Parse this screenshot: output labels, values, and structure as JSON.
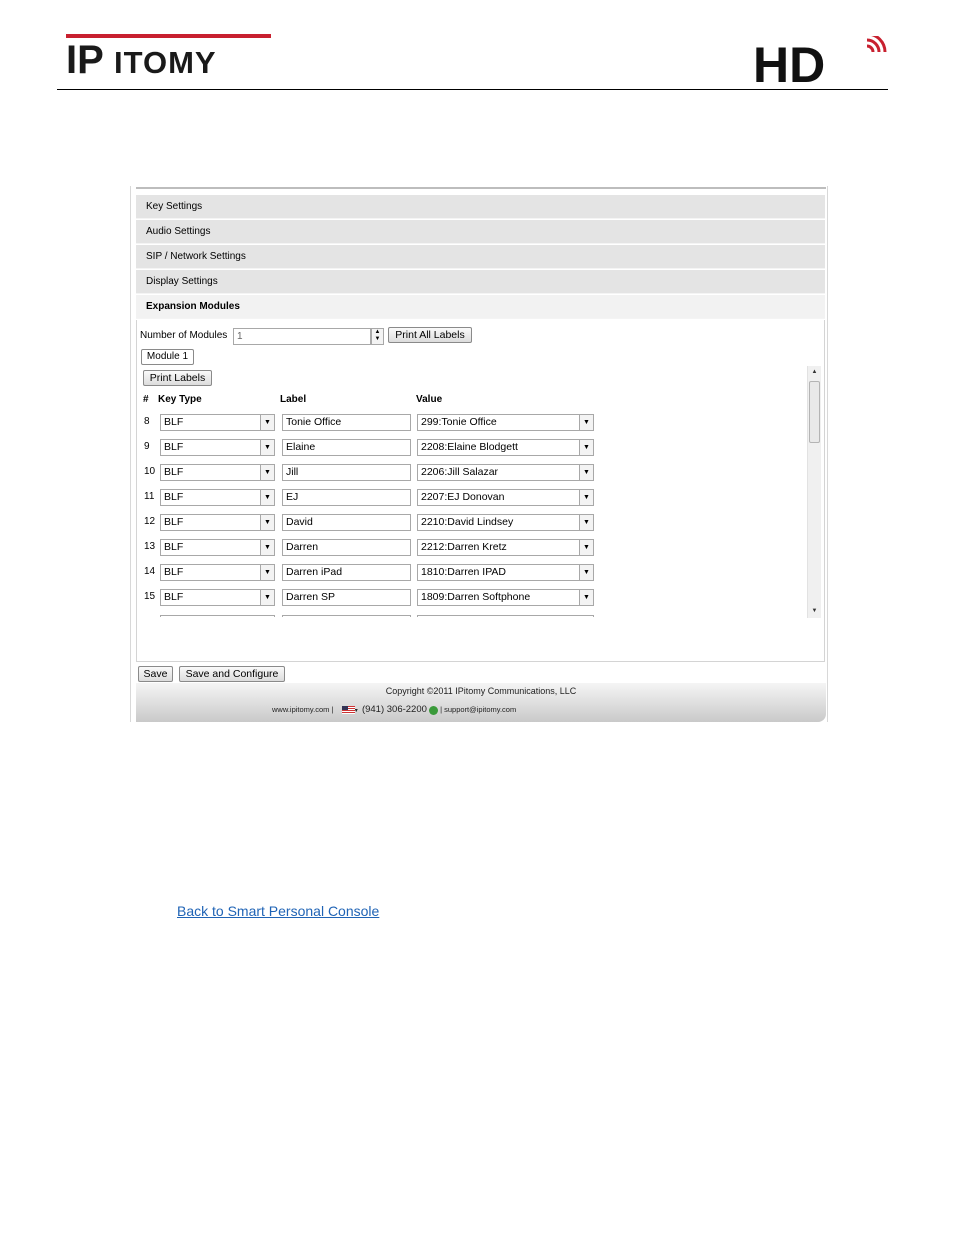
{
  "header": {
    "logo_text": "IPITOMY",
    "hd_logo_text": "HD"
  },
  "accordion": {
    "items": [
      {
        "label": "Key Settings"
      },
      {
        "label": "Audio Settings"
      },
      {
        "label": "SIP / Network Settings"
      },
      {
        "label": "Display Settings"
      },
      {
        "label": "Expansion Modules"
      }
    ],
    "active": "Expansion Modules"
  },
  "expansion": {
    "num_modules_label": "Number of Modules",
    "num_modules_value": "1",
    "print_all_label": "Print All Labels",
    "module_tab": "Module 1",
    "print_labels": "Print Labels",
    "columns": {
      "num": "#",
      "key_type": "Key Type",
      "label": "Label",
      "value": "Value"
    },
    "rows": [
      {
        "num": "8",
        "key_type": "BLF",
        "label": "Tonie Office",
        "value": "299:Tonie Office"
      },
      {
        "num": "9",
        "key_type": "BLF",
        "label": "Elaine",
        "value": "2208:Elaine Blodgett"
      },
      {
        "num": "10",
        "key_type": "BLF",
        "label": "Jill",
        "value": "2206:Jill Salazar"
      },
      {
        "num": "11",
        "key_type": "BLF",
        "label": "EJ",
        "value": "2207:EJ Donovan"
      },
      {
        "num": "12",
        "key_type": "BLF",
        "label": "David",
        "value": "2210:David Lindsey"
      },
      {
        "num": "13",
        "key_type": "BLF",
        "label": "Darren",
        "value": "2212:Darren Kretz"
      },
      {
        "num": "14",
        "key_type": "BLF",
        "label": "Darren iPad",
        "value": "1810:Darren IPAD"
      },
      {
        "num": "15",
        "key_type": "BLF",
        "label": "Darren SP",
        "value": "1809:Darren Softphone"
      }
    ]
  },
  "actions": {
    "save": "Save",
    "save_configure": "Save and Configure"
  },
  "footer": {
    "copyright": "Copyright ©2011 IPitomy Communications, LLC",
    "website": "www.ipitomy.com  |",
    "phone": "(941) 306-2200",
    "email": "| support@ipitomy.com"
  },
  "back_link": "Back to Smart Personal Console"
}
